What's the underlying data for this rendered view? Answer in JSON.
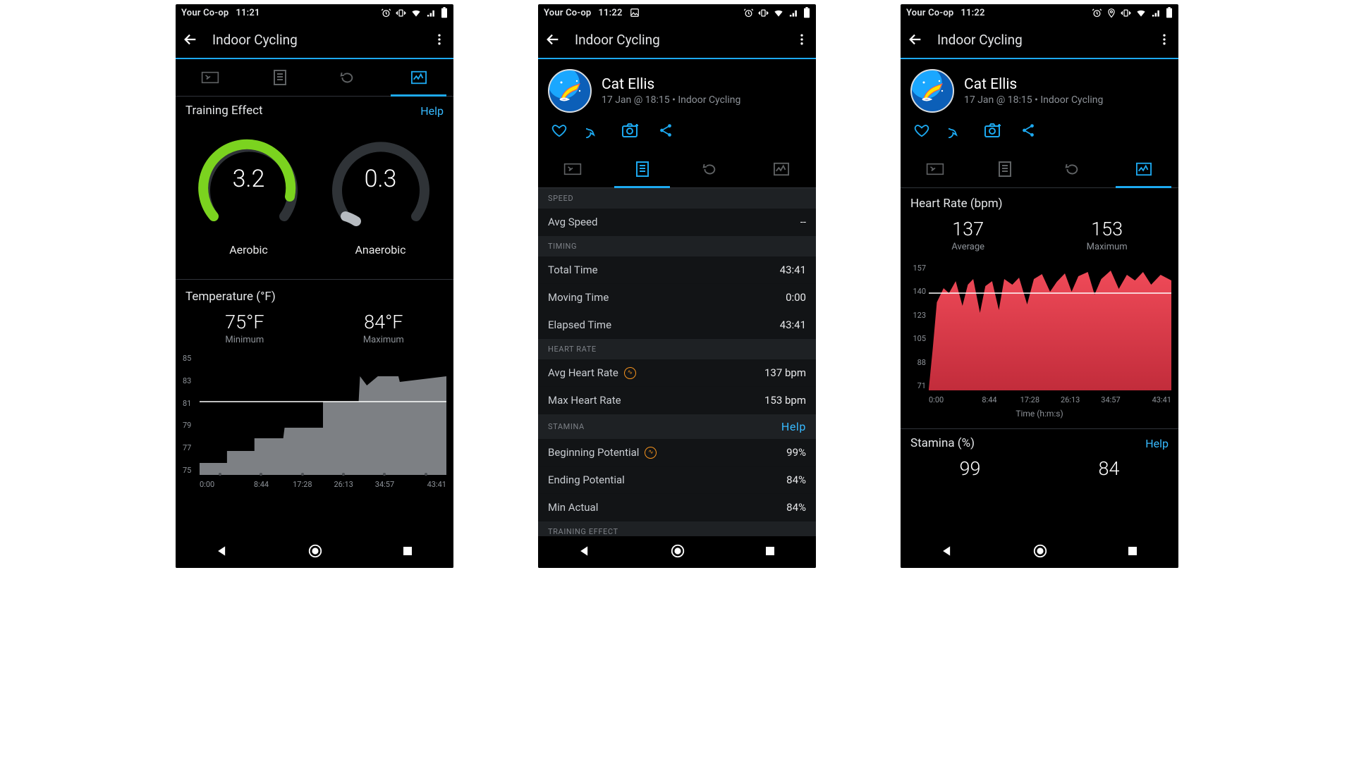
{
  "statusbar": {
    "carrier": "Your Co-op",
    "time1": "11:21",
    "time2": "11:22",
    "time3": "11:22"
  },
  "appbar": {
    "title": "Indoor Cycling"
  },
  "helpLabel": "Help",
  "screen1": {
    "trainingEffect": {
      "title": "Training Effect",
      "aerobic": {
        "label": "Aerobic",
        "value": "3.2"
      },
      "anaerobic": {
        "label": "Anaerobic",
        "value": "0.3"
      }
    },
    "temperature": {
      "title": "Temperature (°F)",
      "minLabel": "Minimum",
      "minValue": "75°F",
      "maxLabel": "Maximum",
      "maxValue": "84°F"
    }
  },
  "screen2": {
    "profile": {
      "name": "Cat Ellis",
      "sub": "17 Jan @ 18:15 • Indoor Cycling"
    },
    "groups": {
      "speed": {
        "hdr": "SPEED",
        "rows": [
          {
            "k": "Avg Speed",
            "v": "--"
          }
        ]
      },
      "timing": {
        "hdr": "TIMING",
        "rows": [
          {
            "k": "Total Time",
            "v": "43:41"
          },
          {
            "k": "Moving Time",
            "v": "0:00"
          },
          {
            "k": "Elapsed Time",
            "v": "43:41"
          }
        ]
      },
      "heart": {
        "hdr": "HEART RATE",
        "rows": [
          {
            "k": "Avg Heart Rate",
            "v": "137 bpm",
            "badge": true
          },
          {
            "k": "Max Heart Rate",
            "v": "153 bpm"
          }
        ]
      },
      "stamina": {
        "hdr": "STAMINA",
        "rows": [
          {
            "k": "Beginning Potential",
            "v": "99%",
            "badge": true
          },
          {
            "k": "Ending Potential",
            "v": "84%"
          },
          {
            "k": "Min Actual",
            "v": "84%"
          }
        ]
      },
      "te": {
        "hdr": "TRAINING EFFECT"
      }
    }
  },
  "screen3": {
    "profile": {
      "name": "Cat Ellis",
      "sub": "17 Jan @ 18:15 • Indoor Cycling"
    },
    "hr": {
      "title": "Heart Rate (bpm)",
      "avgLabel": "Average",
      "avgValue": "137",
      "maxLabel": "Maximum",
      "maxValue": "153",
      "xlabel": "Time (h:m:s)"
    },
    "stamina": {
      "title": "Stamina (%)",
      "left": "99",
      "right": "84"
    }
  },
  "chart_data": [
    {
      "type": "area",
      "id": "temperature_chart",
      "title": "Temperature (°F)",
      "xlabel": "Time (h:m:s)",
      "ylabel": "°F",
      "x_ticks": [
        "0:00",
        "8:44",
        "17:28",
        "26:13",
        "34:57",
        "43:41"
      ],
      "y_ticks": [
        75,
        77,
        79,
        81,
        83,
        85
      ],
      "ylim": [
        75,
        85
      ],
      "series": [
        {
          "name": "Temperature",
          "color": "#8b8e92",
          "x": [
            0,
            5,
            10,
            15,
            22,
            28,
            35,
            43.68
          ],
          "values": [
            76,
            77,
            78,
            79,
            81,
            83,
            84,
            84
          ]
        }
      ],
      "reference_line": 81
    },
    {
      "type": "area",
      "id": "heart_rate_chart",
      "title": "Heart Rate (bpm)",
      "xlabel": "Time (h:m:s)",
      "ylabel": "bpm",
      "x_ticks": [
        "0:00",
        "8:44",
        "17:28",
        "26:13",
        "34:57",
        "43:41"
      ],
      "y_ticks": [
        71,
        88,
        105,
        123,
        140,
        157
      ],
      "ylim": [
        71,
        157
      ],
      "series": [
        {
          "name": "Heart Rate",
          "color": "#e84a59",
          "x": [
            0,
            1,
            2,
            3,
            4,
            6,
            8,
            10,
            12,
            14,
            17,
            20,
            23,
            26,
            29,
            32,
            35,
            38,
            41,
            43.68
          ],
          "values": [
            72,
            100,
            132,
            140,
            138,
            144,
            130,
            148,
            126,
            142,
            148,
            133,
            150,
            140,
            150,
            138,
            152,
            144,
            150,
            146
          ]
        }
      ],
      "reference_line": 137,
      "summary": {
        "average": 137,
        "maximum": 153
      }
    }
  ]
}
